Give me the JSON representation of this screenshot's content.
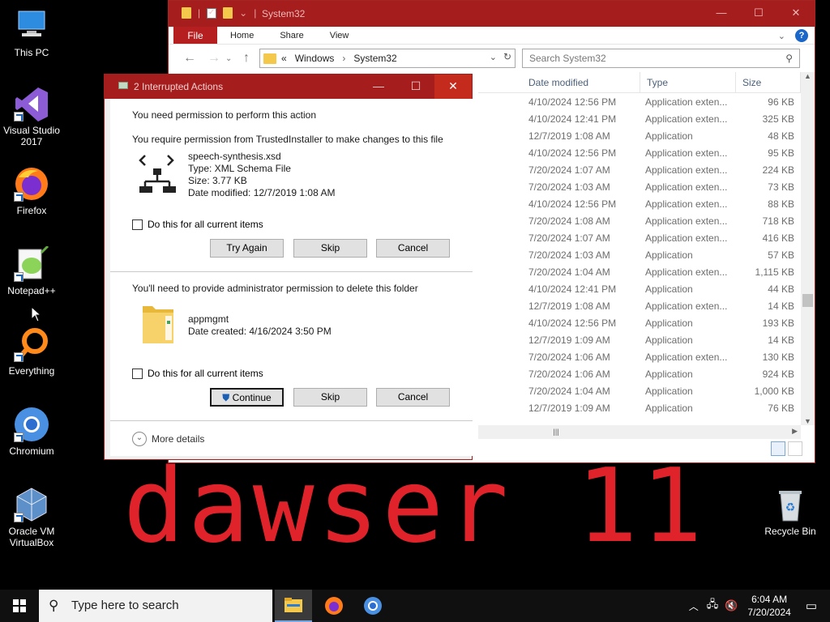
{
  "desktop": {
    "icons": [
      {
        "label": "This PC"
      },
      {
        "label": "Visual Studio 2017"
      },
      {
        "label": "Firefox"
      },
      {
        "label": "Notepad++"
      },
      {
        "label": "Everything"
      },
      {
        "label": "Chromium"
      },
      {
        "label": "Oracle VM VirtualBox"
      },
      {
        "label": "Recycle Bin"
      }
    ],
    "watermark": "dawser 11"
  },
  "explorer": {
    "title": "System32",
    "ribbon_tabs": [
      "File",
      "Home",
      "Share",
      "View"
    ],
    "address": {
      "prefix": "«",
      "parts": [
        "Windows",
        "System32"
      ]
    },
    "search_placeholder": "Search System32",
    "columns": {
      "date": "Date modified",
      "type": "Type",
      "size": "Size"
    },
    "rows": [
      {
        "date": "4/10/2024 12:56 PM",
        "type": "Application exten...",
        "size": "96 KB"
      },
      {
        "date": "4/10/2024 12:41 PM",
        "type": "Application exten...",
        "size": "325 KB"
      },
      {
        "date": "12/7/2019 1:08 AM",
        "type": "Application",
        "size": "48 KB"
      },
      {
        "date": "4/10/2024 12:56 PM",
        "type": "Application exten...",
        "size": "95 KB"
      },
      {
        "date": "7/20/2024 1:07 AM",
        "type": "Application exten...",
        "size": "224 KB"
      },
      {
        "date": "7/20/2024 1:03 AM",
        "type": "Application exten...",
        "size": "73 KB"
      },
      {
        "date": "4/10/2024 12:56 PM",
        "type": "Application exten...",
        "size": "88 KB"
      },
      {
        "date": "7/20/2024 1:08 AM",
        "type": "Application exten...",
        "size": "718 KB"
      },
      {
        "date": "7/20/2024 1:07 AM",
        "type": "Application exten...",
        "size": "416 KB"
      },
      {
        "date": "7/20/2024 1:03 AM",
        "type": "Application",
        "size": "57 KB"
      },
      {
        "date": "7/20/2024 1:04 AM",
        "type": "Application exten...",
        "size": "1,115 KB"
      },
      {
        "date": "4/10/2024 12:41 PM",
        "type": "Application",
        "size": "44 KB"
      },
      {
        "date": "12/7/2019 1:08 AM",
        "type": "Application exten...",
        "size": "14 KB"
      },
      {
        "date": "4/10/2024 12:56 PM",
        "type": "Application",
        "size": "193 KB"
      },
      {
        "date": "12/7/2019 1:09 AM",
        "type": "Application",
        "size": "14 KB"
      },
      {
        "date": "7/20/2024 1:06 AM",
        "type": "Application exten...",
        "size": "130 KB"
      },
      {
        "date": "7/20/2024 1:06 AM",
        "type": "Application",
        "size": "924 KB"
      },
      {
        "date": "7/20/2024 1:04 AM",
        "type": "Application",
        "size": "1,000 KB"
      },
      {
        "date": "12/7/2019 1:09 AM",
        "type": "Application",
        "size": "76 KB"
      }
    ]
  },
  "dialog": {
    "title": "2 Interrupted Actions",
    "heading": "You need permission to perform this action",
    "item1": {
      "message": "You require permission from TrustedInstaller to make changes to this file",
      "name": "speech-synthesis.xsd",
      "type": "Type: XML Schema File",
      "size": "Size: 3.77 KB",
      "date": "Date modified: 12/7/2019 1:08 AM",
      "checkbox": "Do this for all current items",
      "buttons": [
        "Try Again",
        "Skip",
        "Cancel"
      ]
    },
    "item2": {
      "message": "You'll need to provide administrator permission to delete this folder",
      "name": "appmgmt",
      "date": "Date created: 4/16/2024 3:50 PM",
      "checkbox": "Do this for all current items",
      "buttons": [
        "Continue",
        "Skip",
        "Cancel"
      ]
    },
    "more_details": "More details"
  },
  "taskbar": {
    "search_placeholder": "Type here to search",
    "time": "6:04 AM",
    "date": "7/20/2024"
  },
  "colors": {
    "accent": "#a51d1d",
    "watermark": "#e0232b",
    "taskbar": "#101010"
  }
}
